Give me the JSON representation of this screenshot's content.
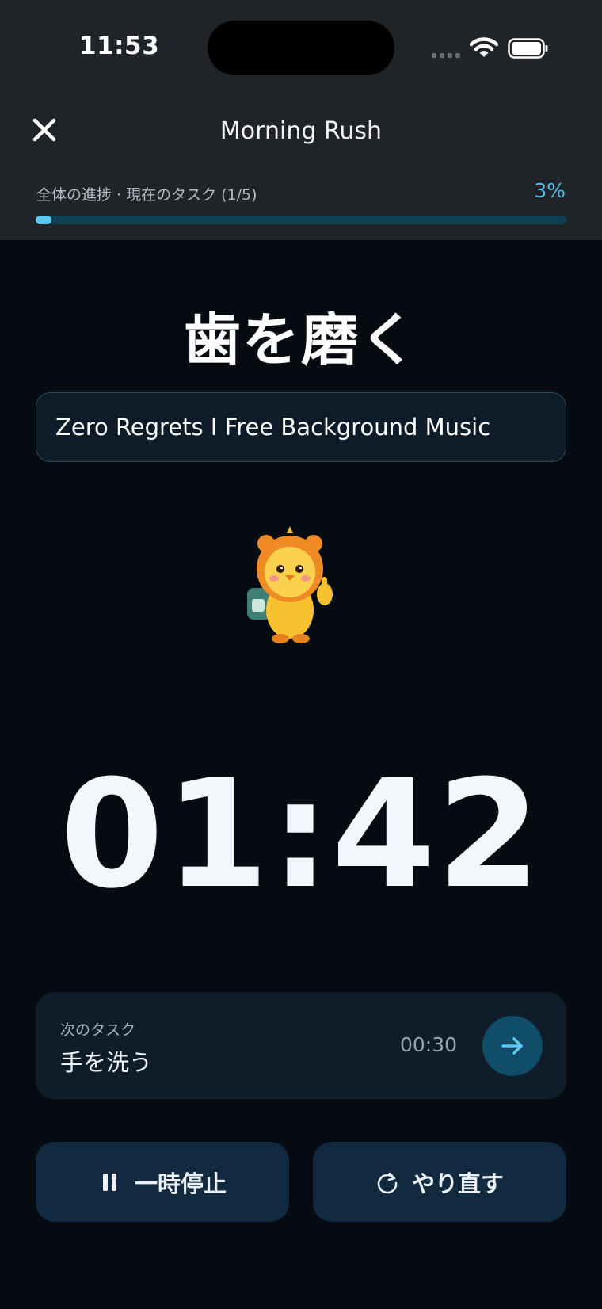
{
  "status_bar": {
    "time": "11:53"
  },
  "header": {
    "title": "Morning Rush",
    "progress_label": "全体の進捗 · 現在のタスク (1/5)",
    "progress_percent_text": "3%",
    "progress_value": 0.03
  },
  "current_task": {
    "title": "歯を磨く",
    "music": "Zero Regrets I Free Background Music",
    "timer": "01:42"
  },
  "next_task": {
    "label": "次のタスク",
    "name": "手を洗う",
    "duration": "00:30"
  },
  "controls": {
    "pause_label": "一時停止",
    "redo_label": "やり直す"
  },
  "colors": {
    "accent": "#4fbfe6",
    "header_bg": "#202327",
    "screen_bg": "#060b12",
    "button_bg": "#112a40"
  },
  "icons": {
    "close": "close-icon",
    "next": "arrow-right-icon",
    "pause": "pause-icon",
    "redo": "redo-icon",
    "mascot": "chick-mascot-image"
  }
}
